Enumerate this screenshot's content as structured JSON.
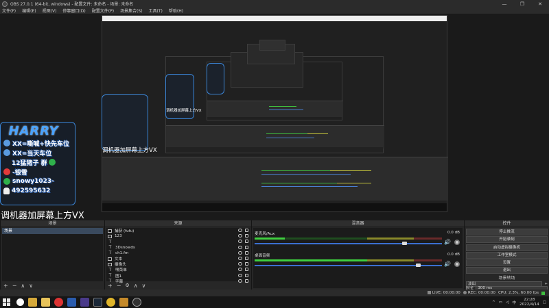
{
  "window": {
    "title": "OBS 27.0.1 (64-bit, windows) - 配置文件: 未命名 - 场景: 未命名",
    "controls": [
      "—",
      "❐",
      "✕"
    ]
  },
  "menu": [
    "文件(F)",
    "编辑(E)",
    "视图(V)",
    "停靠窗口(D)",
    "配置文件(P)",
    "场景集合(S)",
    "工具(T)",
    "帮助(H)"
  ],
  "overlay": {
    "logo": "HARRY",
    "lines": [
      {
        "icon": "qq-icon",
        "text": "XX=嘶喊+快先车位"
      },
      {
        "icon": "qq-icon",
        "text": "XX=当天车位"
      },
      {
        "icon": "wechat-icon",
        "text": "12猛猪子 群"
      },
      {
        "icon": "upload-icon",
        "text": "-银雪"
      },
      {
        "icon": "wechat-icon",
        "text": "snowy1023-"
      },
      {
        "icon": "person-icon",
        "text": "492595632"
      }
    ]
  },
  "preview_caption": "调机器加屏幕上方VX",
  "docks": {
    "scenes": {
      "title": "场景",
      "items": [
        "场景"
      ]
    },
    "sources": {
      "title": "来源",
      "items": [
        {
          "icon": "display-icon",
          "label": "捕获 (fufu)"
        },
        {
          "icon": "display-icon",
          "label": "123"
        },
        {
          "icon": "text-icon",
          "label": ""
        },
        {
          "icon": "text-icon",
          "label": "3Dsnowds"
        },
        {
          "icon": "text-icon",
          "label": "ch1.fm"
        },
        {
          "icon": "image-icon",
          "label": "文本"
        },
        {
          "icon": "camera-icon",
          "label": "摄像头"
        },
        {
          "icon": "text-icon",
          "label": "嘿菜单"
        },
        {
          "icon": "text-icon",
          "label": "图1"
        },
        {
          "icon": "text-icon",
          "label": "字幕"
        }
      ]
    },
    "mixer": {
      "title": "混音器",
      "channels": [
        {
          "name": "麦克风/Aux",
          "db": "0.0 dB",
          "level": 0.16,
          "volume": 0.8
        },
        {
          "name": "桌面音频",
          "db": "0.0 dB",
          "level": 0.73,
          "volume": 0.87
        }
      ]
    },
    "controls": {
      "title": "控件",
      "buttons": [
        "停止推流",
        "开始录制",
        "启动虚拟摄像机",
        "工作室模式",
        "设置",
        "退出"
      ]
    },
    "transitions": {
      "title": "场景转场",
      "current": "淡出",
      "duration_label": "时长",
      "duration_value": "300 ms"
    }
  },
  "footer_buttons": {
    "add": "+",
    "remove": "−",
    "up": "∧",
    "down": "∨"
  },
  "status": {
    "live": "LIVE: 00:00:00",
    "rec": "REC: 00:00:00",
    "cpu": "CPU: 2.3%, 60.00 fps"
  },
  "taskbar": {
    "time": "22:28",
    "date": "2022/4/14",
    "apps": [
      "clock-icon",
      "folder-icon",
      "folder-icon",
      "netease-icon",
      "word-icon",
      "media-icon",
      "steam-icon",
      "chrome-icon",
      "tool-icon",
      "obs-icon"
    ]
  }
}
